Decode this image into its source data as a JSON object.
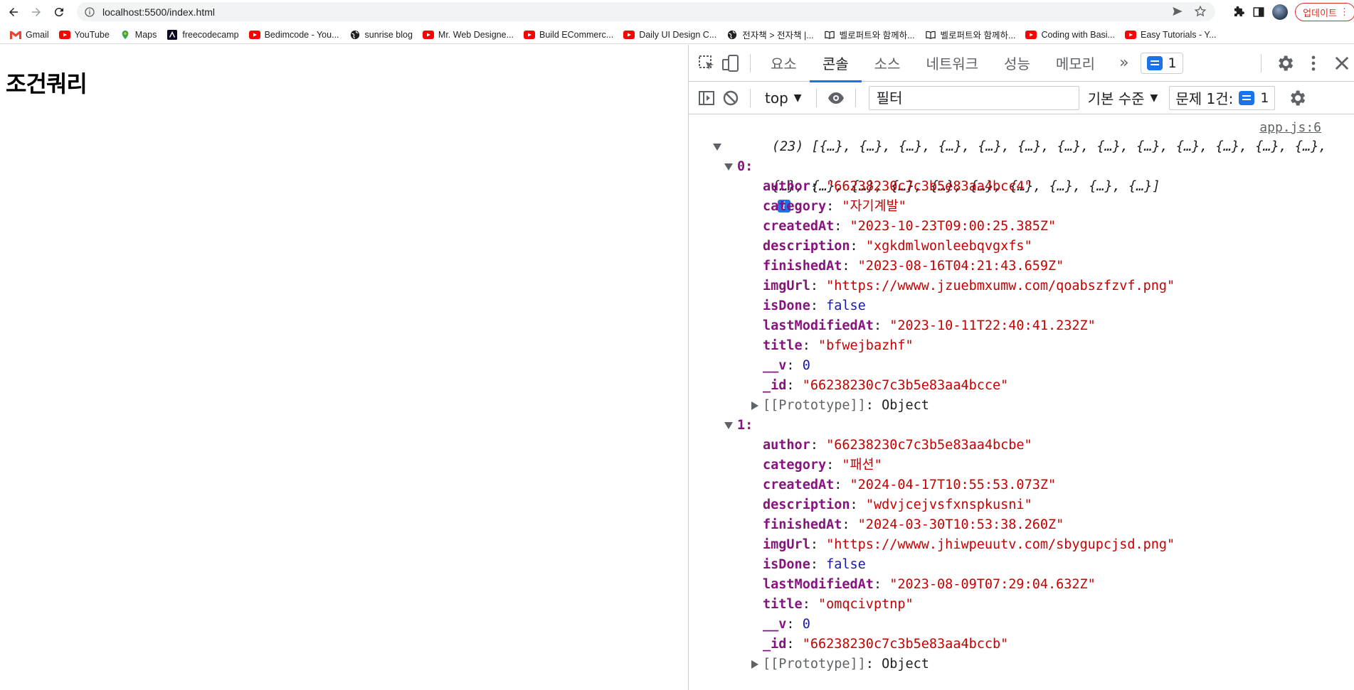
{
  "browser": {
    "url": "localhost:5500/index.html",
    "update_label": "업데이트",
    "bookmarks": [
      {
        "label": "Gmail",
        "icon": "gmail-icon",
        "color": "#ea4335"
      },
      {
        "label": "YouTube",
        "icon": "youtube-icon",
        "color": "#ff0000"
      },
      {
        "label": "Maps",
        "icon": "maps-icon",
        "color": "#34a853"
      },
      {
        "label": "freecodecamp",
        "icon": "freecodecamp-icon",
        "color": "#0a0a23"
      },
      {
        "label": "Bedimcode - You...",
        "icon": "youtube-icon",
        "color": "#ff0000"
      },
      {
        "label": "sunrise blog",
        "icon": "globe-icon",
        "color": "#202124"
      },
      {
        "label": "Mr. Web Designe...",
        "icon": "youtube-icon",
        "color": "#ff0000"
      },
      {
        "label": "Build ECommerc...",
        "icon": "youtube-icon",
        "color": "#ff0000"
      },
      {
        "label": "Daily UI Design C...",
        "icon": "youtube-icon",
        "color": "#ff0000"
      },
      {
        "label": "전자책 > 전자책 |...",
        "icon": "globe-icon",
        "color": "#202124"
      },
      {
        "label": "벨로퍼트와 함께하...",
        "icon": "book-icon",
        "color": "#202124"
      },
      {
        "label": "벨로퍼트와 함께하...",
        "icon": "book-icon",
        "color": "#202124"
      },
      {
        "label": "Coding with Basi...",
        "icon": "youtube-icon",
        "color": "#ff0000"
      },
      {
        "label": "Easy Tutorials - Y...",
        "icon": "youtube-icon",
        "color": "#ff0000"
      }
    ]
  },
  "page": {
    "heading": "조건쿼리"
  },
  "devtools": {
    "tabs": [
      {
        "label": "요소",
        "active": false
      },
      {
        "label": "콘솔",
        "active": true
      },
      {
        "label": "소스",
        "active": false
      },
      {
        "label": "네트워크",
        "active": false
      },
      {
        "label": "성능",
        "active": false
      },
      {
        "label": "메모리",
        "active": false
      }
    ],
    "more_tabs": "»",
    "message_count": "1",
    "context": "top",
    "filter_placeholder": "필터",
    "levels": "기본 수준",
    "issues_label": "문제 1건:",
    "issues_count": "1",
    "accent": "#1a73e8"
  },
  "console": {
    "source": "app.js:6",
    "array_preview_line1": "(23) [{…}, {…}, {…}, {…}, {…}, {…}, {…}, {…}, {…}, {…}, {…}, {…}, {…},",
    "array_preview_line2": "{…}, {…}, {…}, {…}, {…}, {…}, {…}, {…}, {…}, {…}]",
    "items": [
      {
        "index": "0:",
        "fields": [
          {
            "key": "author",
            "value": "\"66238230c7c3b5e83aa4bcc4\"",
            "type": "str"
          },
          {
            "key": "category",
            "value": "\"자기계발\"",
            "type": "str"
          },
          {
            "key": "createdAt",
            "value": "\"2023-10-23T09:00:25.385Z\"",
            "type": "str"
          },
          {
            "key": "description",
            "value": "\"xgkdmlwonleebqvgxfs\"",
            "type": "str"
          },
          {
            "key": "finishedAt",
            "value": "\"2023-08-16T04:21:43.659Z\"",
            "type": "str"
          },
          {
            "key": "imgUrl",
            "value": "\"https://wwww.jzuebmxumw.com/qoabszfzvf.png\"",
            "type": "str"
          },
          {
            "key": "isDone",
            "value": "false",
            "type": "kw"
          },
          {
            "key": "lastModifiedAt",
            "value": "\"2023-10-11T22:40:41.232Z\"",
            "type": "str"
          },
          {
            "key": "title",
            "value": "\"bfwejbazhf\"",
            "type": "str"
          },
          {
            "key": "__v",
            "value": "0",
            "type": "num"
          },
          {
            "key": "_id",
            "value": "\"66238230c7c3b5e83aa4bcce\"",
            "type": "str"
          }
        ],
        "prototype": "[[Prototype]]",
        "prototype_value": "Object"
      },
      {
        "index": "1:",
        "fields": [
          {
            "key": "author",
            "value": "\"66238230c7c3b5e83aa4bcbe\"",
            "type": "str"
          },
          {
            "key": "category",
            "value": "\"패션\"",
            "type": "str"
          },
          {
            "key": "createdAt",
            "value": "\"2024-04-17T10:55:53.073Z\"",
            "type": "str"
          },
          {
            "key": "description",
            "value": "\"wdvjcejvsfxnspkusni\"",
            "type": "str"
          },
          {
            "key": "finishedAt",
            "value": "\"2024-03-30T10:53:38.260Z\"",
            "type": "str"
          },
          {
            "key": "imgUrl",
            "value": "\"https://wwww.jhiwpeuutv.com/sbygupcjsd.png\"",
            "type": "str"
          },
          {
            "key": "isDone",
            "value": "false",
            "type": "kw"
          },
          {
            "key": "lastModifiedAt",
            "value": "\"2023-08-09T07:29:04.632Z\"",
            "type": "str"
          },
          {
            "key": "title",
            "value": "\"omqcivptnp\"",
            "type": "str"
          },
          {
            "key": "__v",
            "value": "0",
            "type": "num"
          },
          {
            "key": "_id",
            "value": "\"66238230c7c3b5e83aa4bccb\"",
            "type": "str"
          }
        ],
        "prototype": "[[Prototype]]",
        "prototype_value": "Object"
      }
    ]
  }
}
